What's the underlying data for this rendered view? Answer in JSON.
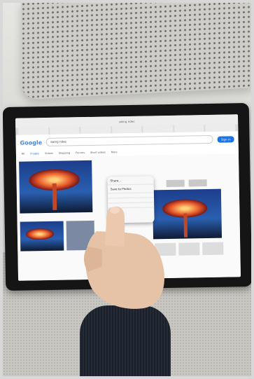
{
  "browser": {
    "address": "swing rides",
    "tabs": [
      "",
      "",
      "",
      "",
      "",
      "",
      ""
    ]
  },
  "google": {
    "logo": "Google",
    "query": "swing rides",
    "signin": "Sign in",
    "filters": [
      "All",
      "Images",
      "Videos",
      "Shopping",
      "Forums",
      "Short videos",
      "More"
    ]
  },
  "context_menu": {
    "items": [
      "Share...",
      "Save to Photos",
      "",
      "",
      ""
    ]
  },
  "colors": {
    "sky": "#2a5fb0",
    "canopy": "#e85a2a",
    "signin": "#1a73e8",
    "sleeve": "#1f2430"
  }
}
